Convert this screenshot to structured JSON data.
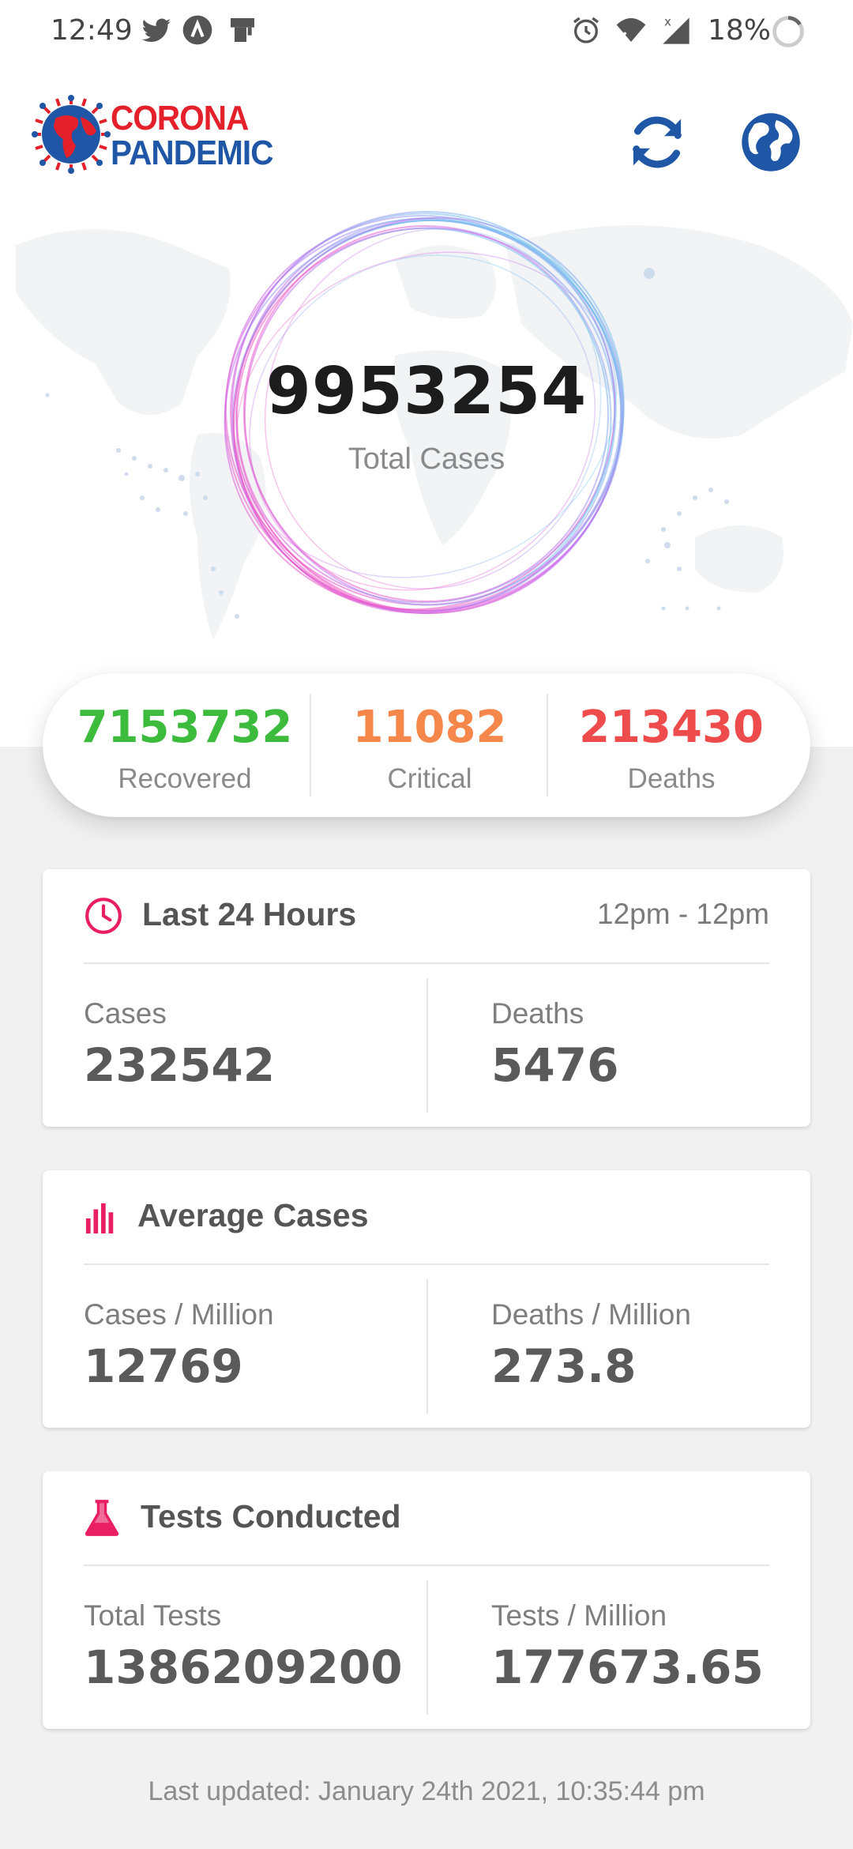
{
  "status_bar": {
    "time": "12:49",
    "battery": "18%",
    "icons": [
      "twitter-icon",
      "app-icon",
      "notification-icon",
      "alarm-icon",
      "wifi-icon",
      "signal-icon",
      "battery-icon"
    ]
  },
  "header": {
    "logo_line1": "CORONA",
    "logo_line2": "PANDEMIC",
    "refresh_icon": "refresh-icon",
    "globe_icon": "globe-icon"
  },
  "hero": {
    "total_cases": "9953254",
    "total_label": "Total Cases"
  },
  "summary": {
    "recovered": {
      "value": "7153732",
      "label": "Recovered"
    },
    "critical": {
      "value": "11082",
      "label": "Critical"
    },
    "deaths": {
      "value": "213430",
      "label": "Deaths"
    }
  },
  "cards": {
    "last24": {
      "title": "Last 24 Hours",
      "subtitle": "12pm - 12pm",
      "left_label": "Cases",
      "left_value": "232542",
      "right_label": "Deaths",
      "right_value": "5476"
    },
    "average": {
      "title": "Average Cases",
      "left_label": "Cases / Million",
      "left_value": "12769",
      "right_label": "Deaths / Million",
      "right_value": "273.8"
    },
    "tests": {
      "title": "Tests Conducted",
      "left_label": "Total Tests",
      "left_value": "1386209200",
      "right_label": "Tests / Million",
      "right_value": "177673.65"
    }
  },
  "footer": "Last updated: January 24th 2021, 10:35:44 pm",
  "colors": {
    "recovered": "#3dbb3d",
    "critical": "#f6874a",
    "deaths": "#ee4c4c",
    "accent_pink": "#e91e63",
    "brand_blue": "#1f56a6",
    "brand_red": "#e4202b"
  }
}
